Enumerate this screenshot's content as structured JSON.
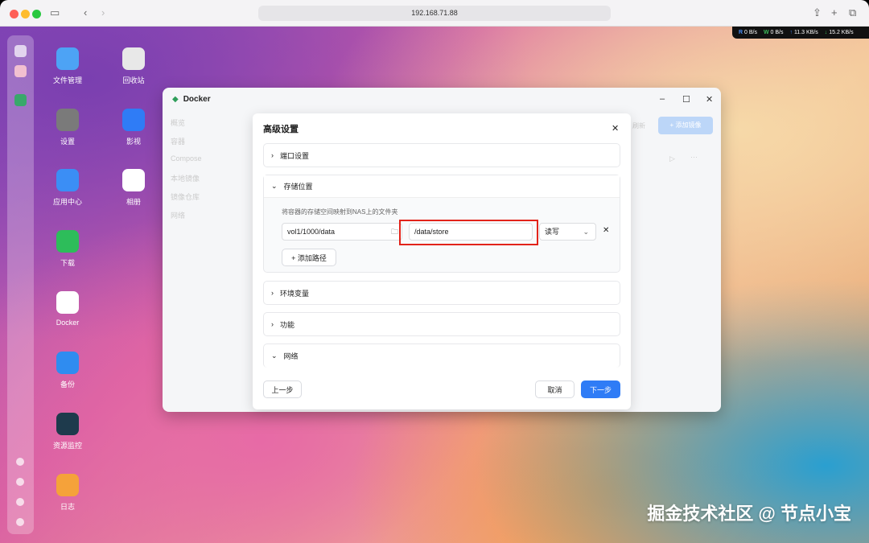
{
  "browser": {
    "url": "192.168.71.88"
  },
  "netstat": {
    "read": "0 B/s",
    "write": "0 B/s",
    "up": "11.3 KB/s",
    "down": "15.2 KB/s"
  },
  "desktop": {
    "apps": [
      {
        "label": "文件管理",
        "icon": "folder-icon",
        "color": "#4da3f5"
      },
      {
        "label": "回收站",
        "icon": "recycle-icon",
        "color": "#e8e8e8"
      },
      {
        "label": "设置",
        "icon": "gear-icon",
        "color": "#7a7a7a"
      },
      {
        "label": "影视",
        "icon": "video-icon",
        "color": "#2f7cf6"
      },
      {
        "label": "应用中心",
        "icon": "store-icon",
        "color": "#3b8ef5"
      },
      {
        "label": "相册",
        "icon": "photos-icon",
        "color": "#ffffff"
      },
      {
        "label": "下载",
        "icon": "download-icon",
        "color": "#2dbd5a"
      },
      {
        "label": "Docker",
        "icon": "docker-icon",
        "color": "#ffffff"
      },
      {
        "label": "备份",
        "icon": "backup-icon",
        "color": "#2f8cf0"
      },
      {
        "label": "资源监控",
        "icon": "monitor-icon",
        "color": "#1e3a4c"
      },
      {
        "label": "日志",
        "icon": "log-icon",
        "color": "#f5a23a"
      }
    ]
  },
  "docker": {
    "title": "Docker",
    "sidebar": [
      "概览",
      "容器",
      "Compose",
      "本地镜像",
      "镜像仓库",
      "网络"
    ],
    "refresh": "刷新",
    "add_image": "+ 添加镜像"
  },
  "modal": {
    "title": "高级设置",
    "sections": {
      "ports": "端口设置",
      "storage": "存储位置",
      "env": "环境变量",
      "features": "功能",
      "network": "网络"
    },
    "storage_desc": "将容器的存储空间映射到NAS上的文件夹",
    "host_path": "vol1/1000/data",
    "container_path": "/data/store",
    "mode": "读写",
    "add_path": "+ 添加路径",
    "prev": "上一步",
    "cancel": "取消",
    "next": "下一步"
  },
  "watermark": "掘金技术社区 @ 节点小宝"
}
